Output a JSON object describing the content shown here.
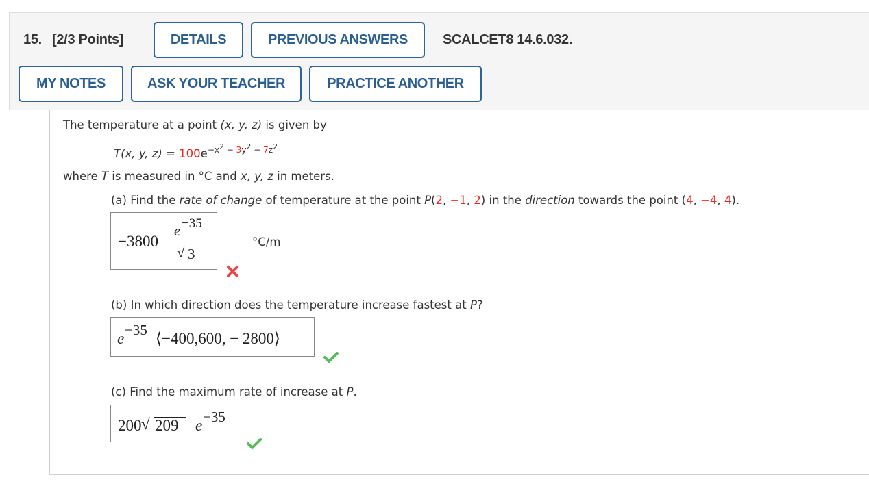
{
  "header": {
    "question_number": "15.",
    "points": "[2/3 Points]",
    "details_label": "DETAILS",
    "previous_answers_label": "PREVIOUS ANSWERS",
    "problem_id": "SCALCET8 14.6.032.",
    "my_notes_label": "MY NOTES",
    "ask_teacher_label": "ASK YOUR TEACHER",
    "practice_another_label": "PRACTICE ANOTHER"
  },
  "problem": {
    "intro_1": "The temperature at a point ",
    "intro_point": "(x, y, z)",
    "intro_2": " is given by",
    "function_lhs": "T(x, y, z)",
    "function_eq": " = ",
    "function_coef": "100",
    "function_e": "e",
    "function_exp_1": "−x",
    "function_exp_2": "2",
    "function_exp_3": " − ",
    "function_exp_4": "3",
    "function_exp_5": "y",
    "function_exp_6": "2",
    "function_exp_7": " − ",
    "function_exp_8": "7",
    "function_exp_9": "z",
    "function_exp_10": "2",
    "where_1": "where ",
    "where_T": "T",
    "where_2": " is measured in °C and ",
    "where_vars": "x, y, z",
    "where_3": " in meters."
  },
  "part_a": {
    "q_1": "(a) Find the ",
    "q_rate": "rate of change",
    "q_2": " of temperature at the point ",
    "q_P": "P",
    "q_p_open": "(",
    "q_p_x": "2",
    "q_p_y": "−1",
    "q_p_z": "2",
    "q_p_close": ")",
    "q_3": " in the ",
    "q_direction": "direction",
    "q_4": " towards the point ",
    "q_t_open": "(",
    "q_t_x": "4",
    "q_t_y": "−4",
    "q_t_z": "4",
    "q_t_close": ").",
    "comma": ", ",
    "answer_coef": "−3800",
    "answer_num_e": "e",
    "answer_num_exp": "−35",
    "answer_den_sqrt": "√",
    "answer_den": "3",
    "unit": "°C/m",
    "status": "incorrect",
    "status_color": "#e8484a"
  },
  "part_b": {
    "q_1": "(b) In which direction does the temperature increase fastest at ",
    "q_P": "P",
    "q_2": "?",
    "answer_e": "e",
    "answer_exp": "−35",
    "answer_vector": "⟨−400,600, − 2800⟩",
    "status": "correct",
    "status_color": "#5cb85c"
  },
  "part_c": {
    "q_1": "(c) Find the maximum rate of increase at ",
    "q_P": "P",
    "q_2": ".",
    "answer_coef": "200",
    "answer_sqrt": "√",
    "answer_radicand": "209",
    "answer_e": "e",
    "answer_exp": "−35",
    "status": "correct",
    "status_color": "#5cb85c"
  }
}
